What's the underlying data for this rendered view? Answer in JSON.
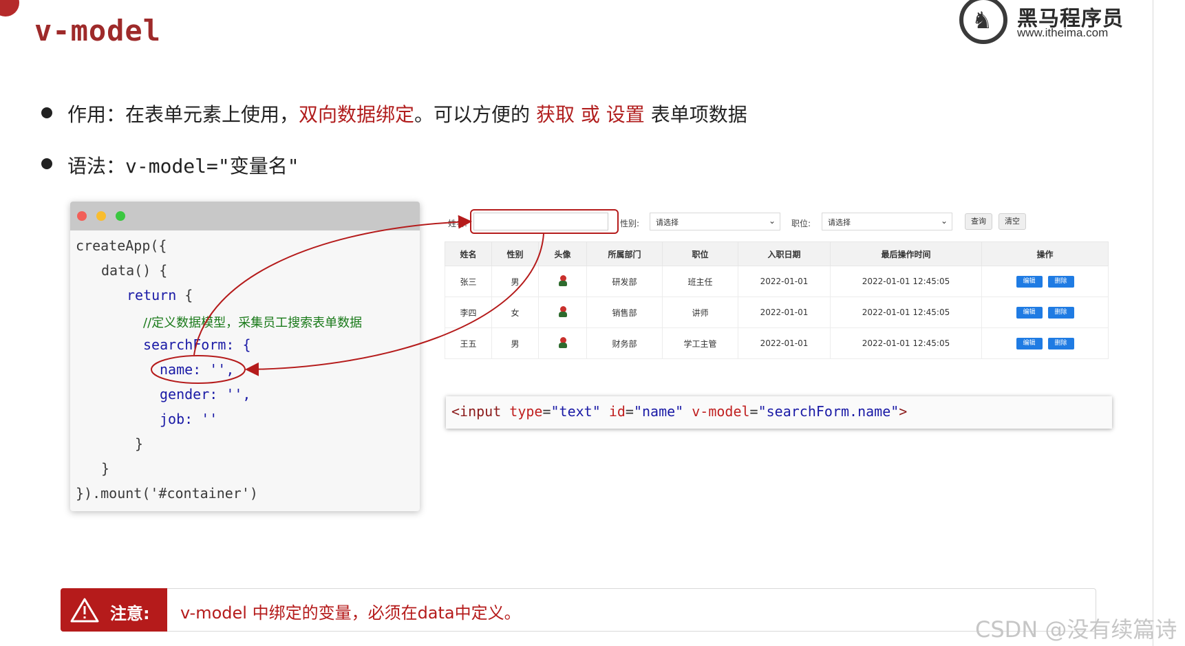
{
  "header": {
    "title": "v-model",
    "logo_name": "黑马程序员",
    "logo_url": "www.itheima.com"
  },
  "bullets": [
    {
      "prefix": "作用：在表单元素上使用，",
      "highlight1": "双向数据绑定",
      "mid": "。可以方便的 ",
      "highlight2": "获取",
      "sep": " ",
      "highlight3": "或",
      "sep2": " ",
      "highlight4": "设置",
      "suffix": " 表单项数据"
    },
    {
      "prefix": "语法：",
      "code": "v-model=\"变量名\""
    }
  ],
  "code_window": {
    "lines": [
      "createApp({",
      "data() {",
      "return",
      "{",
      "//定义数据模型，采集员工搜索表单数据",
      "searchForm: {",
      "name: '',",
      "gender: '',",
      "job: ''",
      "}",
      "}",
      "}).mount('#container')"
    ]
  },
  "form": {
    "name_label": "姓名:",
    "gender_label": "性别:",
    "gender_value": "请选择",
    "job_label": "职位:",
    "job_value": "请选择",
    "query_button": "查询",
    "clear_button": "清空"
  },
  "table": {
    "headers": [
      "姓名",
      "性别",
      "头像",
      "所属部门",
      "职位",
      "入职日期",
      "最后操作时间",
      "操作"
    ],
    "rows": [
      {
        "name": "张三",
        "gender": "男",
        "dept": "研发部",
        "job": "班主任",
        "date": "2022-01-01",
        "updated": "2022-01-01 12:45:05"
      },
      {
        "name": "李四",
        "gender": "女",
        "dept": "销售部",
        "job": "讲师",
        "date": "2022-01-01",
        "updated": "2022-01-01 12:45:05"
      },
      {
        "name": "王五",
        "gender": "男",
        "dept": "财务部",
        "job": "学工主管",
        "date": "2022-01-01",
        "updated": "2022-01-01 12:45:05"
      }
    ],
    "edit_label": "编辑",
    "delete_label": "删除"
  },
  "input_code": {
    "open": "<input",
    "type_attr": "type",
    "type_val": "\"text\"",
    "id_attr": "id",
    "id_val": "\"name\"",
    "vmodel_attr": "v-model",
    "vmodel_val": "\"searchForm.name\"",
    "close": ">"
  },
  "note": {
    "label": "注意:",
    "text": "v-model 中绑定的变量，必须在data中定义。"
  },
  "watermark": "CSDN @没有续篇诗",
  "colors": {
    "accent_red": "#b11e1e",
    "primary_blue": "#1f7be3"
  }
}
